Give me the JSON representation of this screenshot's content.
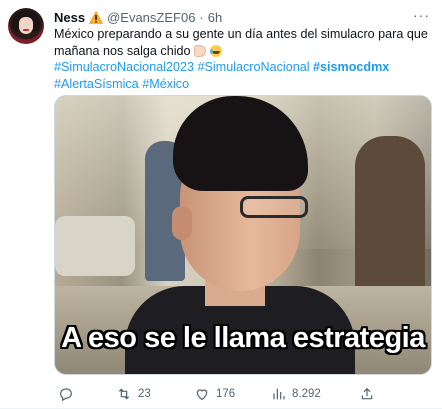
{
  "tweet": {
    "author_name": "Ness",
    "author_badge_icon": "warning-icon",
    "handle": "@EvansZEF06",
    "separator": "·",
    "time": "6h",
    "more_icon": "more-icon",
    "text_lines": [
      "México preparando a su gente un día antes del simulacro para que",
      "mañana nos salga chido"
    ],
    "emojis": [
      "ok-hand-emoji",
      "tears-of-joy-emoji"
    ],
    "hashtags_line1": [
      "#SimulacroNacional2023",
      "#SimulacroNacional",
      "#sismocdmx"
    ],
    "hashtags_line2": [
      "#AlertaSísmica",
      "#México"
    ]
  },
  "media": {
    "caption": "A eso se le llama estrategia"
  },
  "actions": {
    "reply": {
      "icon": "reply-icon",
      "count": ""
    },
    "retweet": {
      "icon": "retweet-icon",
      "count": "23"
    },
    "like": {
      "icon": "heart-icon",
      "count": "176"
    },
    "views": {
      "icon": "views-chart-icon",
      "count": "8.292"
    },
    "share": {
      "icon": "share-icon",
      "count": ""
    }
  },
  "colors": {
    "link": "#1d9bf0",
    "muted": "#536471",
    "text": "#0f1419",
    "warning": "#ffac33"
  }
}
